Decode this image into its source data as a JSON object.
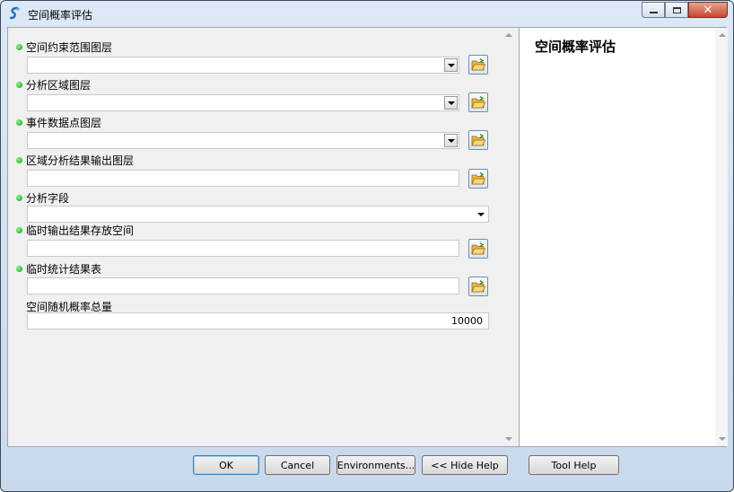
{
  "window": {
    "title": "空间概率评估",
    "close_glyph": "✕"
  },
  "form": {
    "fields": [
      {
        "label": "空间约束范围图层",
        "value": ""
      },
      {
        "label": "分析区域图层",
        "value": ""
      },
      {
        "label": "事件数据点图层",
        "value": ""
      },
      {
        "label": "区域分析结果输出图层",
        "value": ""
      },
      {
        "label": "分析字段",
        "value": ""
      },
      {
        "label": "临时输出结果存放空间",
        "value": ""
      },
      {
        "label": "临时统计结果表",
        "value": ""
      },
      {
        "label": "空间随机概率总量",
        "value": "10000"
      }
    ]
  },
  "help_panel": {
    "title": "空间概率评估"
  },
  "buttons": {
    "ok": "OK",
    "cancel": "Cancel",
    "environments": "Environments...",
    "hide_help": "<< Hide Help",
    "tool_help": "Tool Help"
  },
  "colors": {
    "required_dot": "#22b022",
    "default_button_border": "#3c7fb1"
  }
}
